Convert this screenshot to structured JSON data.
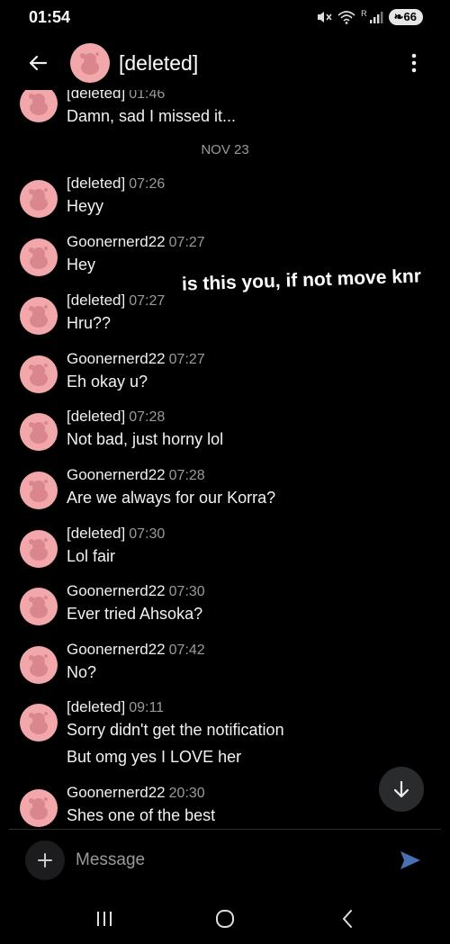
{
  "status_bar": {
    "time": "01:54",
    "battery": "66",
    "network_label": "R"
  },
  "header": {
    "title": "[deleted]"
  },
  "first_message": {
    "author": "[deleted]",
    "time": "01:46",
    "text": "Damn, sad I missed it..."
  },
  "date_separator": "NOV 23",
  "overlay_text": "is this you, if not move knr",
  "messages": [
    {
      "author": "[deleted]",
      "time": "07:26",
      "text": "Heyy"
    },
    {
      "author": "Goonernerd22",
      "time": "07:27",
      "text": "Hey"
    },
    {
      "author": "[deleted]",
      "time": "07:27",
      "text": "Hru??"
    },
    {
      "author": "Goonernerd22",
      "time": "07:27",
      "text": "Eh okay u?"
    },
    {
      "author": "[deleted]",
      "time": "07:28",
      "text": "Not bad, just horny lol"
    },
    {
      "author": "Goonernerd22",
      "time": "07:28",
      "text": "Are we always for our Korra?"
    },
    {
      "author": "[deleted]",
      "time": "07:30",
      "text": "Lol fair"
    },
    {
      "author": "Goonernerd22",
      "time": "07:30",
      "text": "Ever tried Ahsoka?"
    },
    {
      "author": "Goonernerd22",
      "time": "07:42",
      "text": "No?"
    },
    {
      "author": "[deleted]",
      "time": "09:11",
      "text": "Sorry didn't get the notification",
      "text2": "But omg yes I LOVE her"
    },
    {
      "author": "Goonernerd22",
      "time": "20:30",
      "text": "Shes one of the best"
    }
  ],
  "composer": {
    "placeholder": "Message"
  },
  "icons": {
    "back": "arrow-left-icon",
    "menu": "kebab-menu-icon",
    "scroll": "arrow-down-icon",
    "plus": "plus-icon",
    "send": "send-icon",
    "avatar": "reddit-snoo-avatar"
  },
  "colors": {
    "background": "#000000",
    "avatar": "#f2a7ab",
    "send": "#4a6fb3",
    "scroll_button": "#2a2b2d"
  }
}
